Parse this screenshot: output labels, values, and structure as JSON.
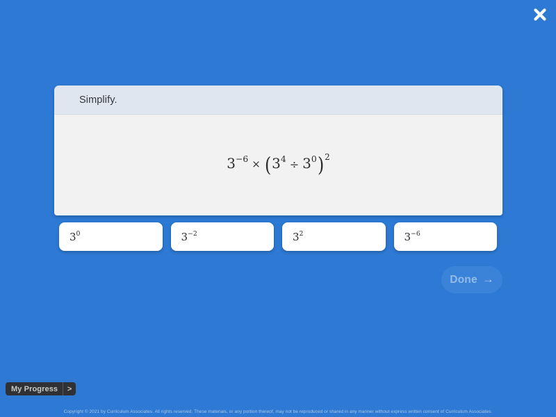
{
  "theme": {
    "background_blue": "#2d79d3",
    "card_header_bg": "#dfe6ef",
    "card_body_bg": "#f2f2f2",
    "choice_bg": "#ffffff",
    "done_button_bg": "#3b83d9",
    "done_button_text": "#93bbe8",
    "progress_pill_bg": "#2f3135",
    "footer_text": "#a9c8e9"
  },
  "window": {
    "close_icon": "close-icon"
  },
  "question": {
    "prompt": "Simplify.",
    "expression_plain": "3^-6 × (3^4 ÷ 3^0)^2",
    "expression": {
      "base1": "3",
      "exp1": "−6",
      "times": "×",
      "open_paren": "(",
      "base2": "3",
      "exp2": "4",
      "divide": "÷",
      "base3": "3",
      "exp3": "0",
      "close_paren": ")",
      "group_exp": "2"
    }
  },
  "choices": [
    {
      "id": "choice-1",
      "base": "3",
      "exponent": "0",
      "plain": "3^0",
      "selected": false
    },
    {
      "id": "choice-2",
      "base": "3",
      "exponent": "−2",
      "plain": "3^-2",
      "selected": false
    },
    {
      "id": "choice-3",
      "base": "3",
      "exponent": "2",
      "plain": "3^2",
      "selected": false
    },
    {
      "id": "choice-4",
      "base": "3",
      "exponent": "−6",
      "plain": "3^-6",
      "selected": false
    }
  ],
  "done_button": {
    "label": "Done",
    "arrow_icon": "arrow-right-icon",
    "arrow_glyph": "→",
    "disabled": true
  },
  "my_progress": {
    "label": "My Progress",
    "chevron": ">",
    "chevron_icon": "chevron-right-icon"
  },
  "footer": {
    "copyright": "Copyright © 2021 by Curriculum Associates. All rights reserved. These materials, or any portion thereof, may not be reproduced or shared in any manner without express written consent of Curriculum Associates."
  }
}
